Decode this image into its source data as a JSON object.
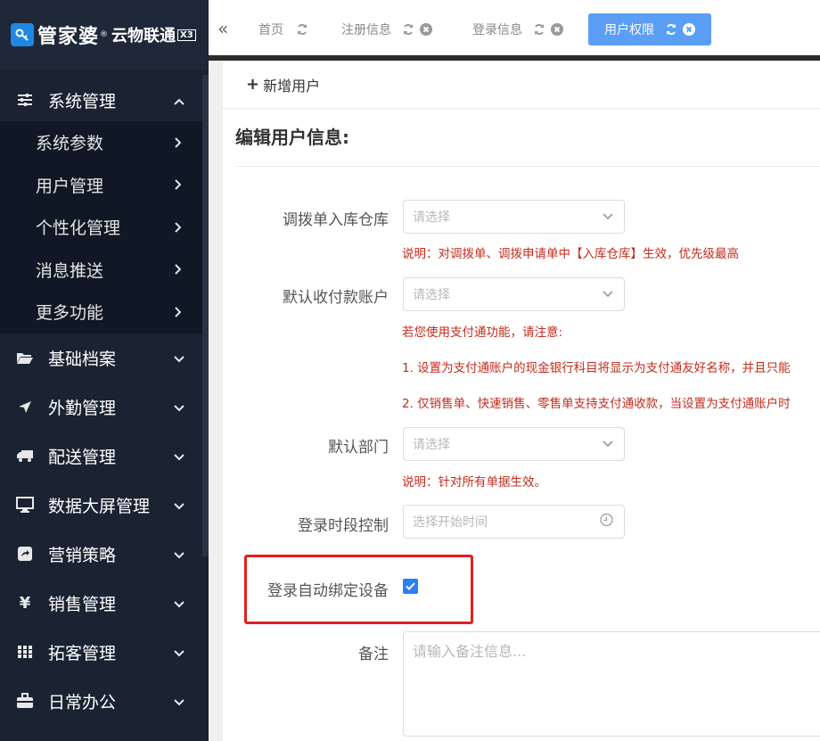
{
  "brand": {
    "name": "管家婆",
    "sub": "云物联通",
    "edition": "X3",
    "reg": "®"
  },
  "sidebar": {
    "expanded": {
      "label": "系统管理",
      "items": [
        {
          "label": "系统参数"
        },
        {
          "label": "用户管理"
        },
        {
          "label": "个性化管理"
        },
        {
          "label": "消息推送"
        },
        {
          "label": "更多功能"
        }
      ]
    },
    "groups": [
      {
        "label": "基础档案",
        "icon": "folder-open-icon"
      },
      {
        "label": "外勤管理",
        "icon": "plane-icon"
      },
      {
        "label": "配送管理",
        "icon": "truck-icon"
      },
      {
        "label": "数据大屏管理",
        "icon": "monitor-icon"
      },
      {
        "label": "营销策略",
        "icon": "share-square-icon"
      },
      {
        "label": "销售管理",
        "icon": "yen-icon"
      },
      {
        "label": "拓客管理",
        "icon": "grid-icon"
      },
      {
        "label": "日常办公",
        "icon": "briefcase-icon"
      }
    ]
  },
  "tabs": [
    {
      "label": "首页",
      "closable": false,
      "active": false
    },
    {
      "label": "注册信息",
      "closable": true,
      "active": false
    },
    {
      "label": "登录信息",
      "closable": true,
      "active": false
    },
    {
      "label": "用户权限",
      "closable": true,
      "active": true
    }
  ],
  "toolbar": {
    "add_label": "新增用户"
  },
  "form": {
    "title": "编辑用户信息:",
    "fields": {
      "warehouse": {
        "label": "调拨单入库仓库",
        "placeholder": "请选择",
        "note": "说明：对调拨单、调拨申请单中【入库仓库】生效，优先级最高"
      },
      "account": {
        "label": "默认收付款账户",
        "placeholder": "请选择",
        "note1": "若您使用支付通功能，请注意:",
        "note2": "1. 设置为支付通账户的现金银行科目将显示为支付通友好名称，并且只能",
        "note3": "2. 仅销售单、快速销售、零售单支持支付通收款，当设置为支付通账户时"
      },
      "department": {
        "label": "默认部门",
        "placeholder": "请选择",
        "note": "说明：针对所有单据生效。"
      },
      "login_time": {
        "label": "登录时段控制",
        "placeholder": "选择开始时间"
      },
      "auto_bind": {
        "label": "登录自动绑定设备",
        "checked": true
      },
      "remark": {
        "label": "备注",
        "placeholder": "请输入备注信息..."
      }
    }
  },
  "colors": {
    "sidebar_bg": "#1a2332",
    "accent": "#5a9ef5",
    "note_red": "#c42b1c",
    "highlight_red": "#e02020"
  }
}
